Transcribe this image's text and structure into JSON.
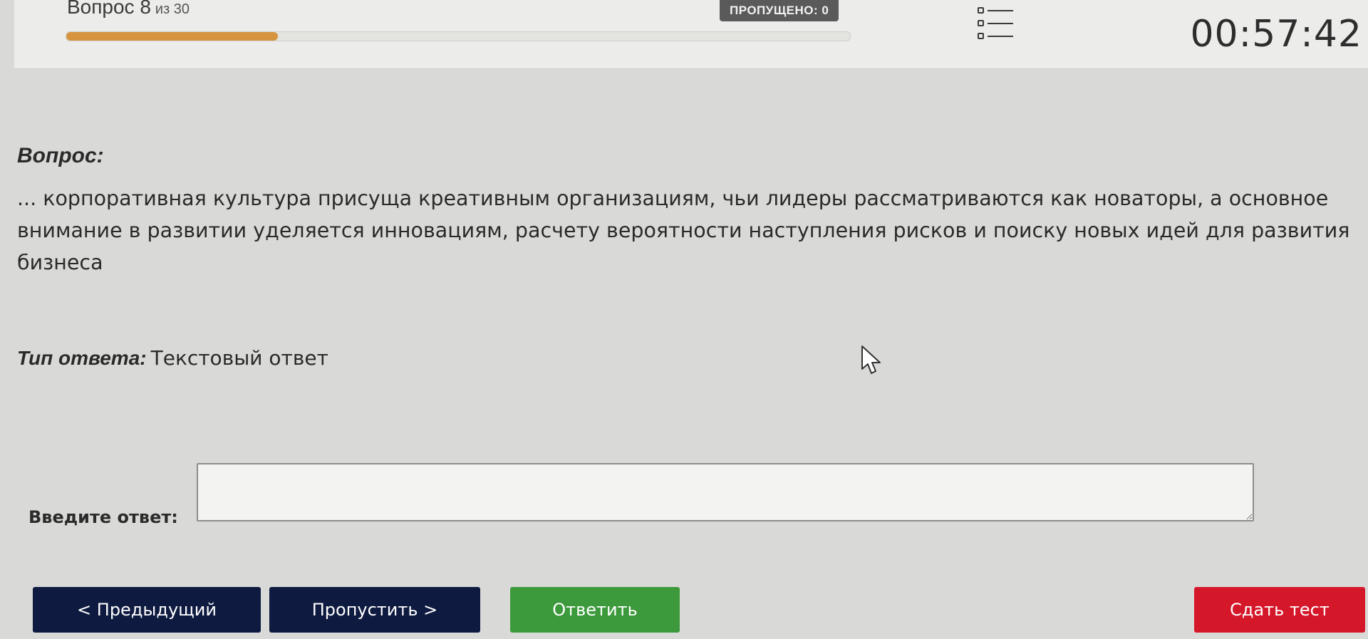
{
  "header": {
    "question_counter": "Вопрос 8",
    "question_counter_total": "из 30",
    "progress_fraction": 0.27,
    "skipped_label": "ПРОПУЩЕНО: 0",
    "question_list_icon": "list-icon",
    "timer": "00:57:42"
  },
  "question": {
    "label": "Вопрос:",
    "text": "... корпоративная культура присуща креативным организациям, чьи лидеры рассматриваются как новаторы, а основное внимание в развитии уделяется инновациям, расчету вероятности наступления рисков и поиску новых идей для развития бизнеса"
  },
  "answer_type": {
    "label": "Тип ответа:",
    "value": "Текстовый ответ"
  },
  "answer": {
    "label": "Введите ответ:",
    "value": ""
  },
  "buttons": {
    "prev": "< Предыдущий",
    "skip": "Пропустить >",
    "answer": "Ответить",
    "submit": "Сдать тест"
  },
  "colors": {
    "progress": "#d7943e",
    "nav_button": "#0e1a3f",
    "answer_button": "#3c9a3c",
    "submit_button": "#d5172a",
    "skipped_badge": "#5a5a5a"
  }
}
